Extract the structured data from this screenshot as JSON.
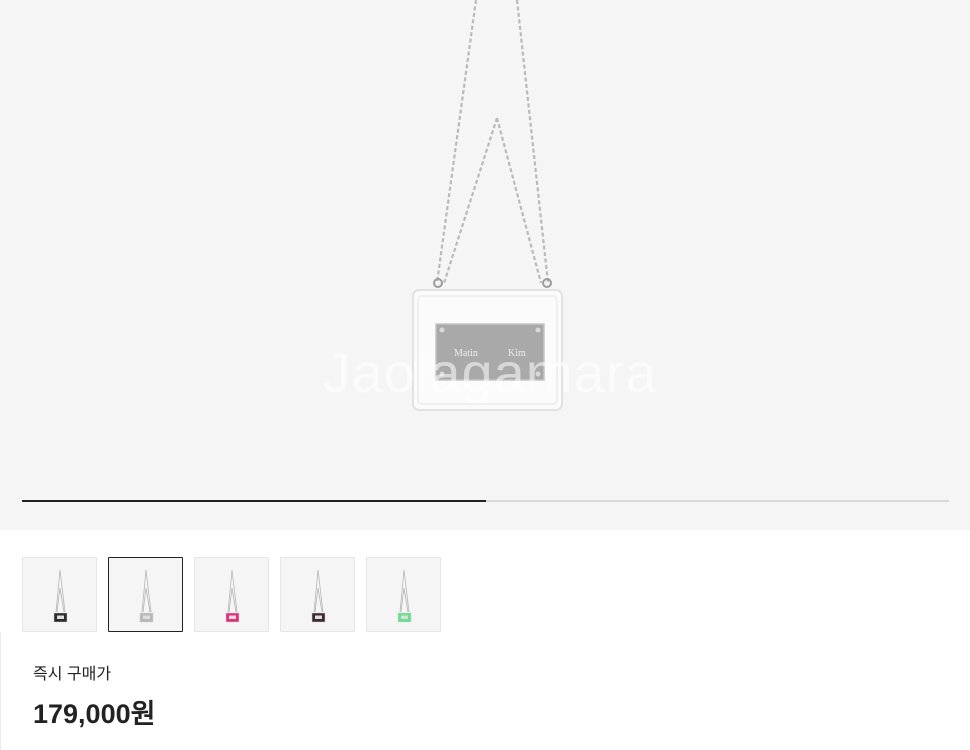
{
  "gallery": {
    "main_image_alt": "Matin Kim clear chain bag",
    "plate_text_left": "Matin",
    "plate_text_right": "Kim",
    "watermark": "Jaolagamara",
    "progress_fraction": 0.5
  },
  "thumbnails": [
    {
      "label": "black",
      "color": "#2a2a2a",
      "selected": false
    },
    {
      "label": "silver",
      "color": "#b8b8b8",
      "selected": true
    },
    {
      "label": "pink",
      "color": "#e0307a",
      "selected": false
    },
    {
      "label": "dark",
      "color": "#3a2a30",
      "selected": false
    },
    {
      "label": "green",
      "color": "#66e08a",
      "selected": false
    }
  ],
  "price": {
    "label": "즉시 구매가",
    "value": "179,000원"
  }
}
